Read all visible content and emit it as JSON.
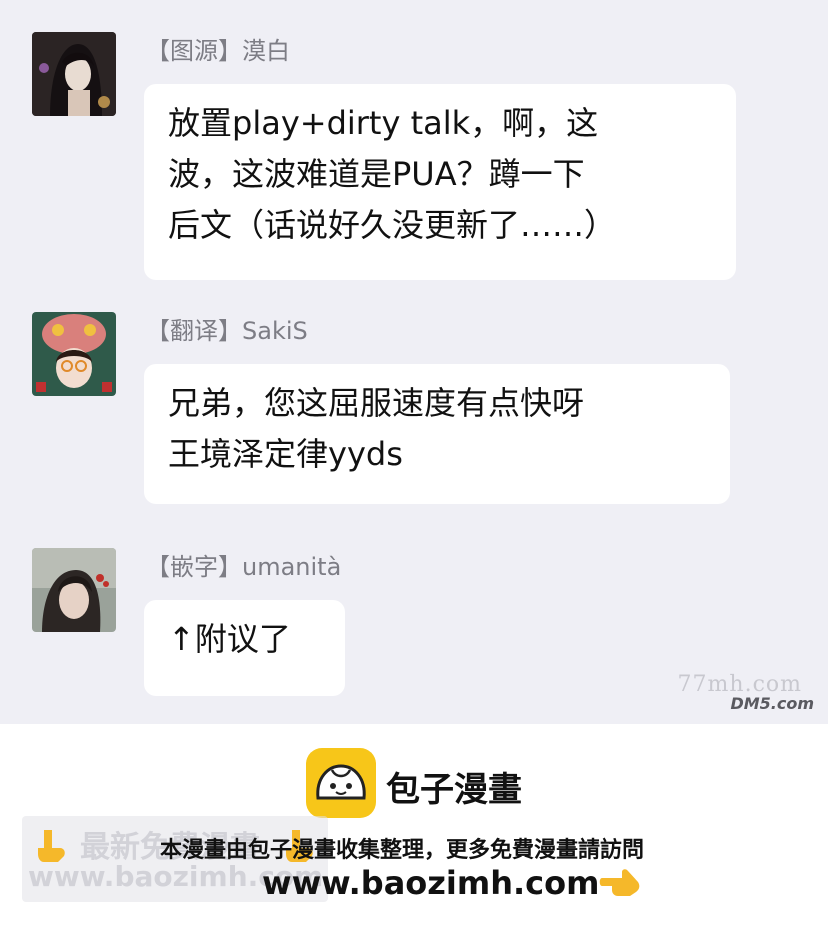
{
  "chat": {
    "messages": [
      {
        "sender": "【图源】漠白",
        "text": "放置play+dirty talk，啊，这\n波，这波难道是PUA？蹲一下\n后文（话说好久没更新了……）"
      },
      {
        "sender": "【翻译】SakiS",
        "text": "兄弟，您这屈服速度有点快呀\n王境泽定律yyds"
      },
      {
        "sender": "【嵌字】umanità",
        "text": "↑附议了"
      }
    ]
  },
  "watermark": {
    "site": "77mh.com",
    "dm5": "DM5.com"
  },
  "footer": {
    "brand_name": "包子漫畫",
    "notice": "本漫畫由包子漫畫收集整理，更多免費漫畫請訪問",
    "url": "www.baozimh.com",
    "ghost_line1": "最新免費漫畫",
    "ghost_line2": "www.baozimh.com"
  },
  "colors": {
    "chat_bg": "#efeff5",
    "bubble": "#ffffff",
    "brand_yellow": "#f7c619"
  },
  "icons": [
    "avatar-moba",
    "avatar-sakis",
    "avatar-umanita",
    "bun-logo-icon",
    "pointing-down-hand-icon",
    "pointing-left-hand-icon"
  ]
}
